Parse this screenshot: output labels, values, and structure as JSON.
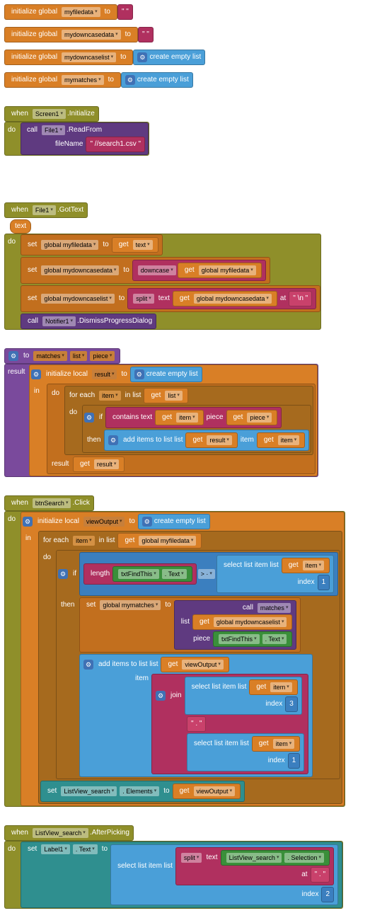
{
  "globals": {
    "myfiledata": {
      "kw": "initialize global",
      "name": "myfiledata",
      "to": "to",
      "val": "\" \""
    },
    "mydowncasedata": {
      "kw": "initialize global",
      "name": "mydowncasedata",
      "to": "to",
      "val": "\" \""
    },
    "mydowncaselist": {
      "kw": "initialize global",
      "name": "mydowncaselist",
      "to": "to",
      "val": "create empty list"
    },
    "mymatches": {
      "kw": "initialize global",
      "name": "mymatches",
      "to": "to",
      "val": "create empty list"
    }
  },
  "screen_init": {
    "when": "when",
    "obj": "Screen1",
    "evt": ".Initialize",
    "do": "do",
    "call": "call",
    "file": "File1",
    "method": ".ReadFrom",
    "param": "fileName",
    "fileval": "\" //search1.csv \""
  },
  "gottext": {
    "when": "when",
    "obj": "File1",
    "evt": ".GotText",
    "param": "text",
    "do": "do",
    "set": "set",
    "to": "to",
    "get": "get",
    "g_myfiledata": "global myfiledata",
    "g_mydowncasedata": "global mydowncasedata",
    "g_mydowncaselist": "global mydowncaselist",
    "text": "text",
    "downcase": "downcase",
    "split": "split",
    "at": "at",
    "nl": "\" \\n \"",
    "call": "call",
    "notifier": "Notifier1",
    "dismiss": ".DismissProgressDialog"
  },
  "proc": {
    "to": "to",
    "name": "matches",
    "a1": "list",
    "a2": "piece",
    "result": "result",
    "initlocal": "initialize local",
    "local": "result",
    "to2": "to",
    "empty": "create empty list",
    "in": "in",
    "foreach": "for each",
    "item": "item",
    "inlist": "in list",
    "get": "get",
    "list": "list",
    "do": "do",
    "if": "if",
    "contains": "contains  text",
    "piece": "piece",
    "then": "then",
    "additems": "add items to list   list",
    "itemlbl": "item",
    "resresult": "result"
  },
  "btn": {
    "when": "when",
    "obj": "btnSearch",
    "evt": ".Click",
    "do": "do",
    "initlocal": "initialize local",
    "local": "viewOutput",
    "to": "to",
    "empty": "create empty list",
    "in": "in",
    "foreach": "for each",
    "item": "item",
    "inlist": "in list",
    "get": "get",
    "g_myfiledata": "global myfiledata",
    "if": "if",
    "length": "length",
    "txtfind": "txtFindThis",
    "textprop": ". Text",
    "gt": "> ·",
    "select": "select list item  list",
    "index": "index",
    "one": "1",
    "then": "then",
    "set": "set",
    "g_mymatches": "global mymatches",
    "call": "call",
    "matches": "matches",
    "list": "list",
    "piece": "piece",
    "g_mydowncaselist": "global mydowncaselist",
    "additems": "add items to list   list",
    "viewOutput": "viewOutput",
    "itemlbl": "item",
    "join": "join",
    "three": "3",
    "dot": "\" . \"",
    "lvsearch": "ListView_search",
    "elements": ". Elements"
  },
  "after": {
    "when": "when",
    "obj": "ListView_search",
    "evt": ".AfterPicking",
    "do": "do",
    "set": "set",
    "label": "Label1",
    "textprop": ". Text",
    "to": "to",
    "select": "select list item  list",
    "split": "split",
    "text": "text",
    "lvsearch": "ListView_search",
    "selection": ". Selection",
    "at": "at",
    "dot": "\" . \"",
    "index": "index",
    "two": "2"
  }
}
